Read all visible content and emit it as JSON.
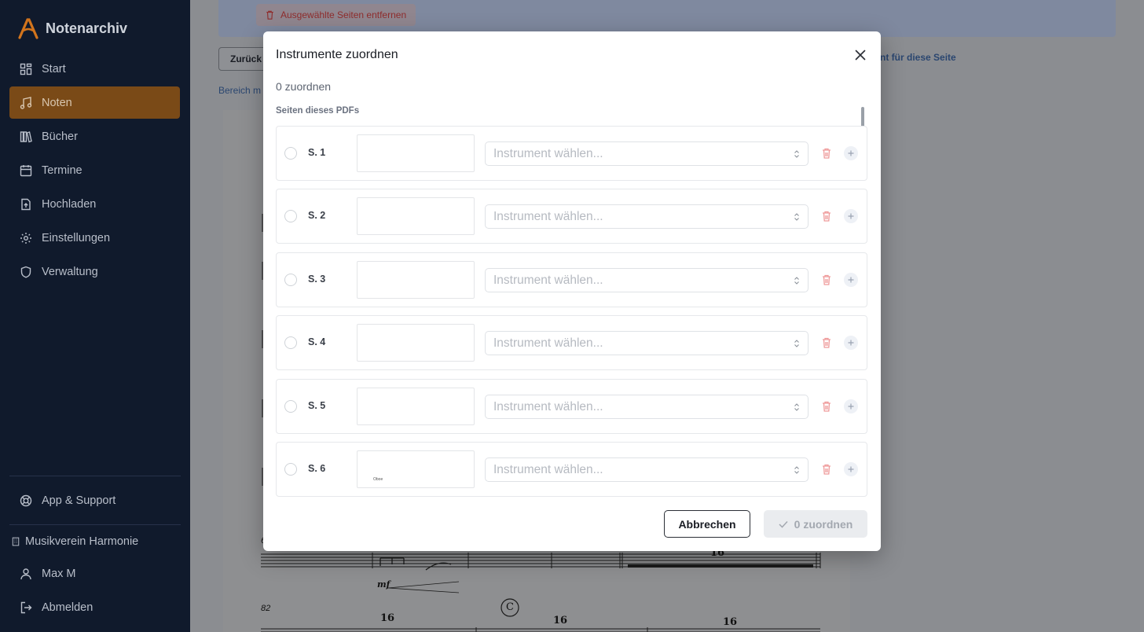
{
  "sidebar": {
    "app_name": "Notenarchiv",
    "nav": [
      {
        "label": "Start",
        "icon": "dashboard-icon"
      },
      {
        "label": "Noten",
        "icon": "music-note-icon",
        "active": true
      },
      {
        "label": "Bücher",
        "icon": "books-icon"
      },
      {
        "label": "Termine",
        "icon": "calendar-icon"
      },
      {
        "label": "Hochladen",
        "icon": "upload-icon"
      },
      {
        "label": "Einstellungen",
        "icon": "gear-icon"
      },
      {
        "label": "Verwaltung",
        "icon": "shield-icon"
      }
    ],
    "support": "App & Support",
    "organization": "Musikverein Harmonie",
    "user": "Max M",
    "logout": "Abmelden",
    "accent_color": "#7a4a17"
  },
  "background": {
    "remove_selected": "Ausgewählte Seiten entfernen",
    "back": "Zurück",
    "range_link": "Bereich m",
    "page_link": "nt für diese Seite",
    "sheet": {
      "measure_numbers": [
        "6",
        "82"
      ],
      "rest_numbers": [
        "16",
        "16",
        "16",
        "16"
      ],
      "dynamic": "mf",
      "rehearsal_mark": "C"
    }
  },
  "modal": {
    "title": "Instrumente zuordnen",
    "count_text": "0 zuordnen",
    "section_label": "Seiten dieses PDFs",
    "select_placeholder": "Instrument wählen...",
    "pages": [
      {
        "label": "S. 1",
        "thumb_text": ""
      },
      {
        "label": "S. 2",
        "thumb_text": ""
      },
      {
        "label": "S. 3",
        "thumb_text": ""
      },
      {
        "label": "S. 4",
        "thumb_text": ""
      },
      {
        "label": "S. 5",
        "thumb_text": ""
      },
      {
        "label": "S. 6",
        "thumb_text": "Oboe"
      }
    ],
    "cancel": "Abbrechen",
    "confirm": "0 zuordnen"
  }
}
